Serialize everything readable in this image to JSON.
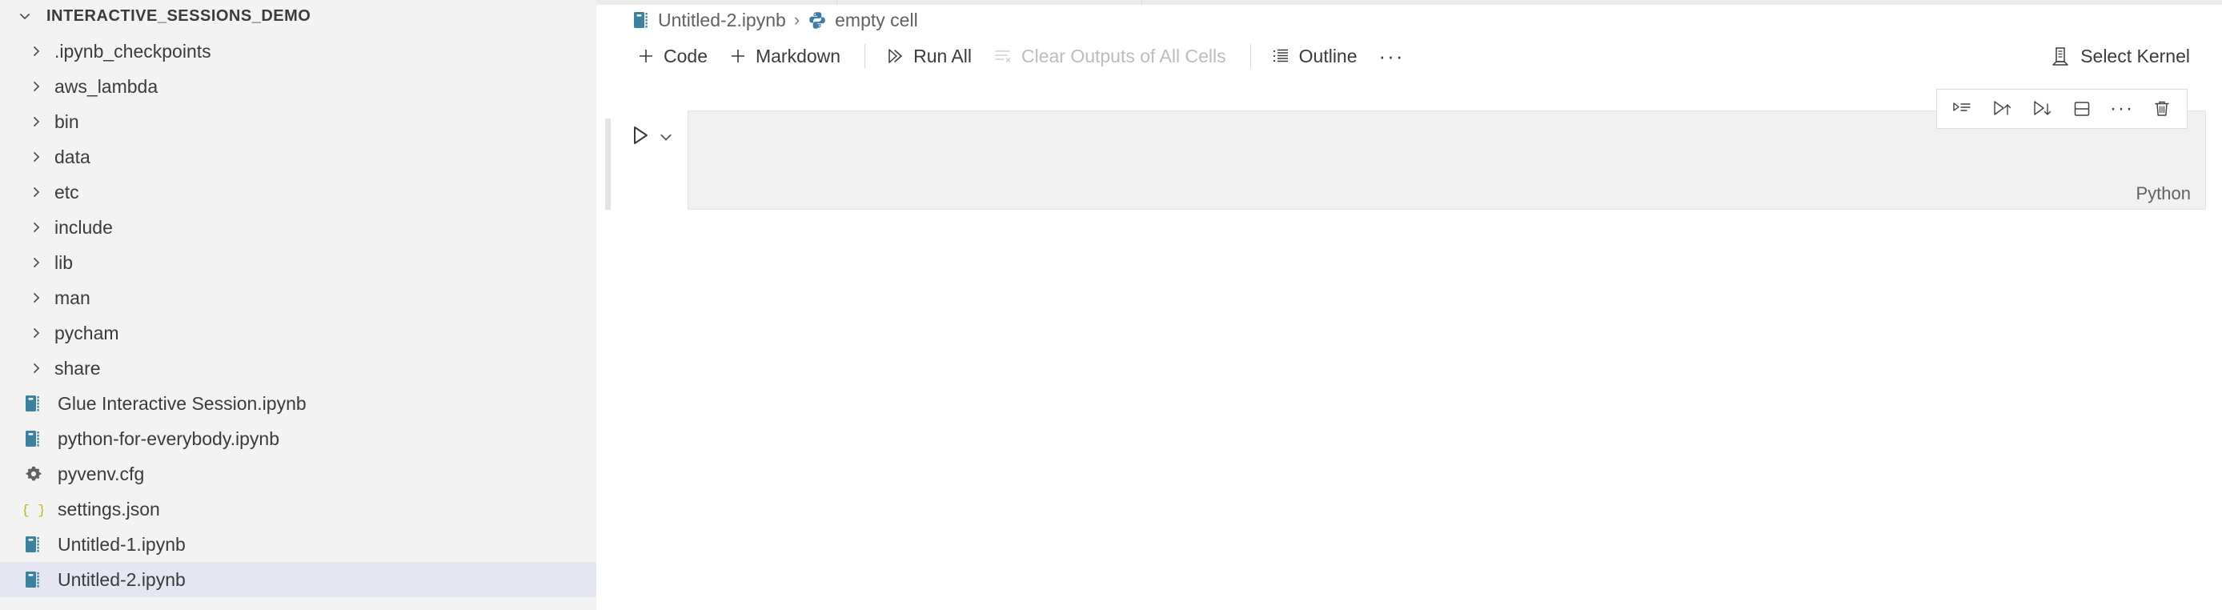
{
  "sidebar": {
    "section_title": "INTERACTIVE_SESSIONS_DEMO",
    "section_twisty": "chevron-down-icon",
    "items": [
      {
        "label": ".ipynb_checkpoints",
        "type": "folder",
        "icon": "chevron-right-icon",
        "selected": false
      },
      {
        "label": "aws_lambda",
        "type": "folder",
        "icon": "chevron-right-icon",
        "selected": false
      },
      {
        "label": "bin",
        "type": "folder",
        "icon": "chevron-right-icon",
        "selected": false
      },
      {
        "label": "data",
        "type": "folder",
        "icon": "chevron-right-icon",
        "selected": false
      },
      {
        "label": "etc",
        "type": "folder",
        "icon": "chevron-right-icon",
        "selected": false
      },
      {
        "label": "include",
        "type": "folder",
        "icon": "chevron-right-icon",
        "selected": false
      },
      {
        "label": "lib",
        "type": "folder",
        "icon": "chevron-right-icon",
        "selected": false
      },
      {
        "label": "man",
        "type": "folder",
        "icon": "chevron-right-icon",
        "selected": false
      },
      {
        "label": "pycham",
        "type": "folder",
        "icon": "chevron-right-icon",
        "selected": false
      },
      {
        "label": "share",
        "type": "folder",
        "icon": "chevron-right-icon",
        "selected": false
      },
      {
        "label": "Glue Interactive Session.ipynb",
        "type": "file",
        "icon": "notebook-icon",
        "selected": false
      },
      {
        "label": "python-for-everybody.ipynb",
        "type": "file",
        "icon": "notebook-icon",
        "selected": false
      },
      {
        "label": "pyvenv.cfg",
        "type": "file",
        "icon": "gear-icon",
        "selected": false
      },
      {
        "label": "settings.json",
        "type": "file",
        "icon": "json-braces-icon",
        "selected": false
      },
      {
        "label": "Untitled-1.ipynb",
        "type": "file",
        "icon": "notebook-icon",
        "selected": false
      },
      {
        "label": "Untitled-2.ipynb",
        "type": "file",
        "icon": "notebook-icon",
        "selected": true
      }
    ]
  },
  "breadcrumb": {
    "file": "Untitled-2.ipynb",
    "file_icon": "notebook-icon",
    "separator": "›",
    "cell": "empty cell",
    "cell_icon": "python-icon"
  },
  "toolbar": {
    "add_code_label": "Code",
    "add_code_icon": "plus-icon",
    "add_markdown_label": "Markdown",
    "add_markdown_icon": "plus-icon",
    "run_all_label": "Run All",
    "run_all_icon": "run-all-icon",
    "clear_outputs_label": "Clear Outputs of All Cells",
    "clear_outputs_icon": "clear-outputs-icon",
    "outline_label": "Outline",
    "outline_icon": "outline-list-icon",
    "more_label": "···",
    "select_kernel_label": "Select Kernel",
    "select_kernel_icon": "kernel-server-icon"
  },
  "cell_toolbar": {
    "buttons": [
      {
        "name": "run-by-line-icon",
        "title": "Run by Line"
      },
      {
        "name": "run-above-icon",
        "title": "Execute Above Cells"
      },
      {
        "name": "run-below-icon",
        "title": "Execute Cell and Below"
      },
      {
        "name": "split-cell-icon",
        "title": "Split Cell"
      },
      {
        "name": "more-actions-icon",
        "title": "···"
      },
      {
        "name": "trash-icon",
        "title": "Delete Cell"
      }
    ],
    "dots": "···"
  },
  "cell": {
    "run_icon": "play-outline-icon",
    "chevron_icon": "chevron-down-icon",
    "content": "",
    "language": "Python"
  },
  "colors": {
    "sidebar_bg": "#f3f3f3",
    "selected_row": "#e4e6f1",
    "notebook_icon": "#3a82a0",
    "json_icon": "#bdb412",
    "gear_icon": "#616161",
    "python_icon_blue": "#3a7bb0",
    "text": "#3b3b3b",
    "muted_text": "#616161",
    "disabled_text": "#bcbcbc",
    "cell_bg": "#f1f1f1",
    "cell_border": "#e4e4e4"
  }
}
